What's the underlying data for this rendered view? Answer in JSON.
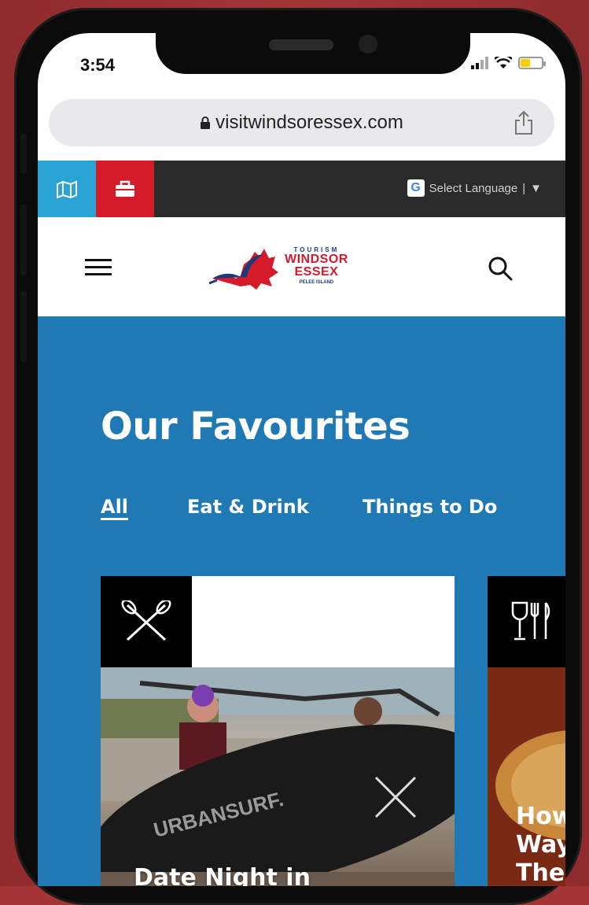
{
  "status_bar": {
    "time": "3:54",
    "battery_level": 0.45,
    "icons": [
      "signal-icon",
      "wifi-icon",
      "battery-icon"
    ]
  },
  "browser": {
    "url": "visitwindsoressex.com",
    "lock_icon": "lock-icon",
    "share_icon": "share-icon"
  },
  "top_nav": {
    "map_icon": "map-icon",
    "briefcase_icon": "briefcase-icon",
    "language_label": "Select Language",
    "language_separator": "|",
    "language_caret": "▼"
  },
  "header": {
    "logo": {
      "small": "TOURISM",
      "line1": "WINDSOR",
      "line2": "ESSEX",
      "sub": "PELEE ISLAND"
    },
    "menu_icon": "menu-icon",
    "search_icon": "search-icon"
  },
  "favourites": {
    "title": "Our Favourites",
    "tabs": [
      {
        "label": "All",
        "active": true
      },
      {
        "label": "Eat & Drink",
        "active": false
      },
      {
        "label": "Things to Do",
        "active": false
      }
    ],
    "cards": [
      {
        "title": "Date Night in",
        "icon": "paddles-icon",
        "image_label": "URBANSURF."
      },
      {
        "title_lines": [
          "How",
          "Way",
          "The"
        ],
        "icon": "wine-cutlery-icon"
      }
    ]
  },
  "colors": {
    "background": "#a33537",
    "nav_dark": "#2b2b2b",
    "map_blue": "#2aa4d4",
    "briefcase_red": "#d51a2a",
    "section_blue": "#1f79b5",
    "brand_red": "#d51a2a",
    "brand_navy": "#1c3a78"
  }
}
